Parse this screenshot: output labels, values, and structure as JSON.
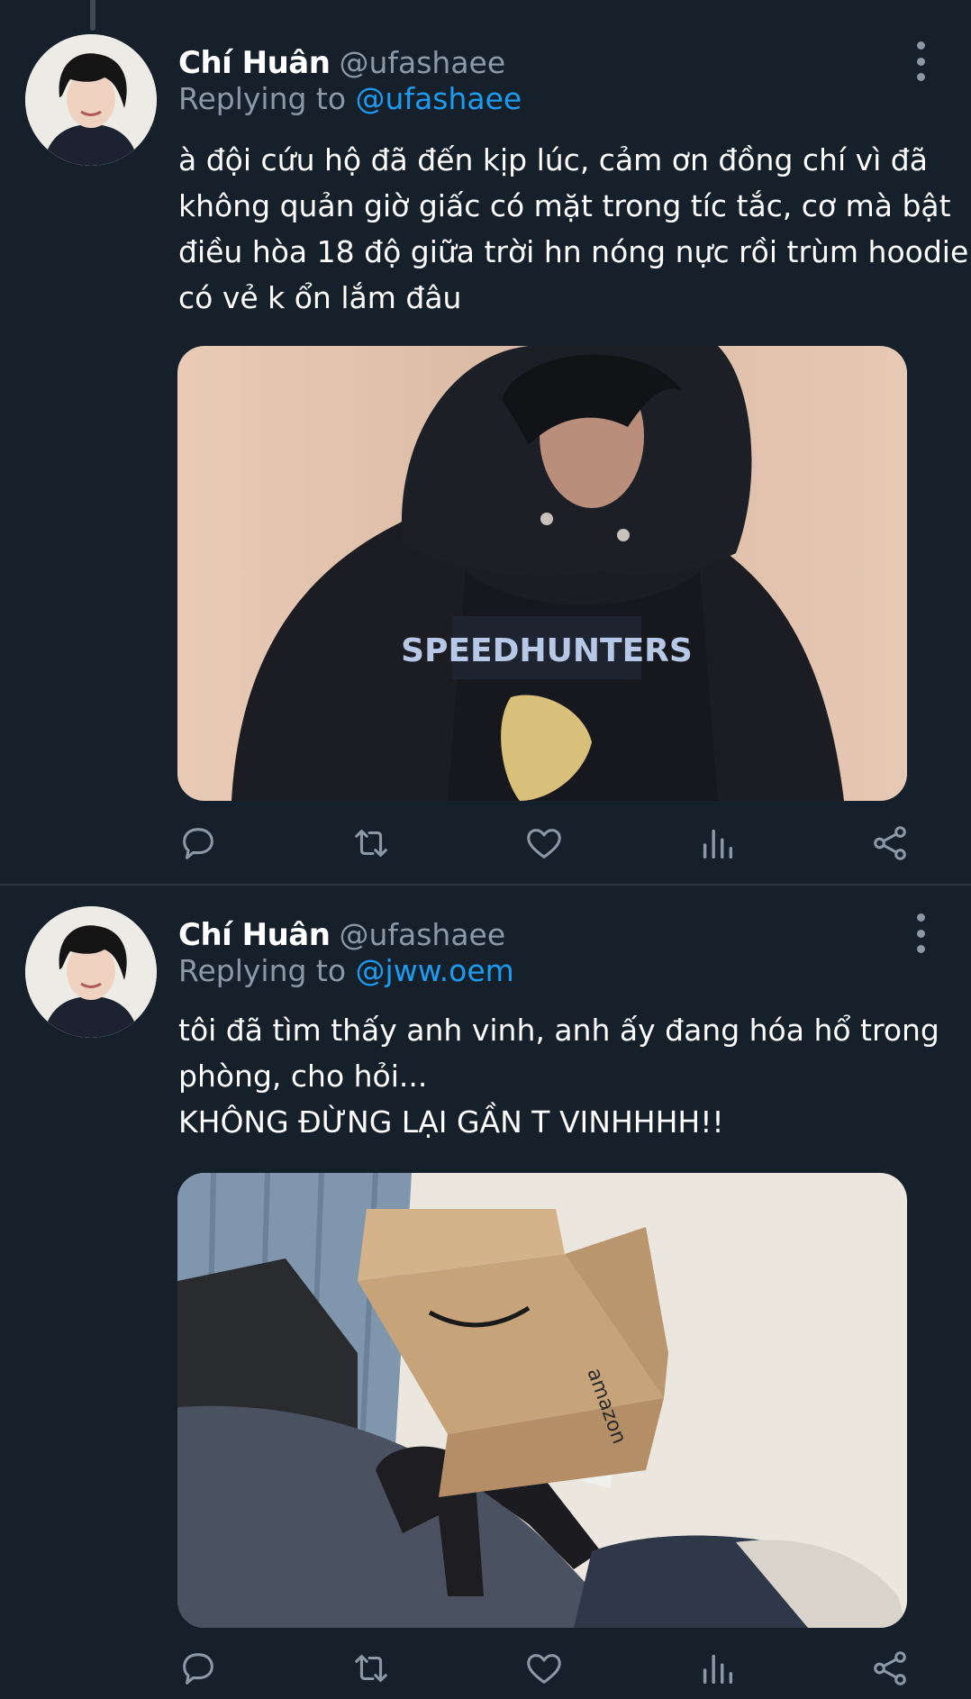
{
  "tweets": [
    {
      "author_name": "Chí Huân",
      "author_handle": "@ufashaee",
      "replying_prefix": "Replying to",
      "replying_to": "@ufashaee",
      "text_lines": [
        "à đội cứu hộ đã đến kịp lúc, cảm ơn đồng chí vì đã",
        "không quản giờ giấc có mặt trong tíc tắc, cơ mà bật",
        "điều hòa 18 độ giữa trời hn nóng nực rồi trùm hoodie",
        "có vẻ k ổn lắm đâu"
      ],
      "photo_print_text": "SPEEDHUNTERS"
    },
    {
      "author_name": "Chí Huân",
      "author_handle": "@ufashaee",
      "replying_prefix": "Replying to",
      "replying_to": "@jww.oem",
      "text_lines": [
        "tôi đã tìm thấy anh vinh, anh ấy đang hóa hổ trong",
        "phòng, cho hỏi...",
        "KHÔNG ĐỪNG LẠI GẦN T VINHHHH!!"
      ],
      "photo_print_text": "amazon"
    }
  ],
  "action_icons": [
    "reply-icon",
    "retweet-icon",
    "like-icon",
    "analytics-icon",
    "share-icon"
  ],
  "colors": {
    "background": "#15202b",
    "primary_text": "#ffffff",
    "secondary_text": "#8b98a5",
    "accent": "#1d9bf0",
    "divider": "#2b3640"
  }
}
